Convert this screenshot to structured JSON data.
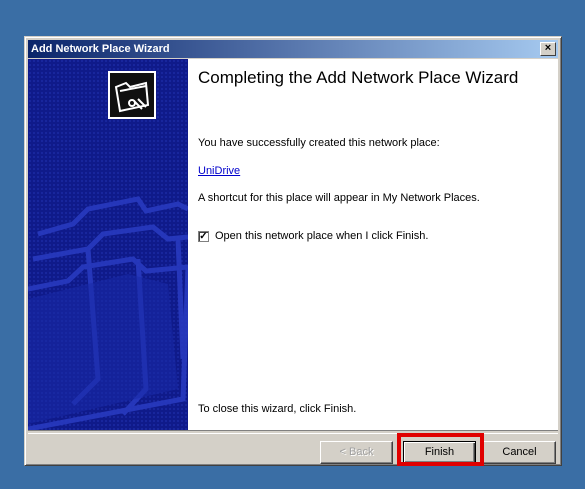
{
  "window": {
    "title": "Add Network Place Wizard",
    "close_label": "×"
  },
  "main": {
    "heading": "Completing the Add Network Place Wizard",
    "success_text": "You have successfully created this network place:",
    "place_name": "UniDrive",
    "shortcut_text": "A shortcut for this place will appear in My Network Places.",
    "open_checkbox": {
      "checked": true,
      "mark": "✓",
      "label": "Open this network place when I click Finish."
    },
    "close_text": "To close this wizard, click Finish."
  },
  "buttons": {
    "back_label": "< Back",
    "finish_label": "Finish",
    "cancel_label": "Cancel"
  },
  "colors": {
    "side_panel": "#0f1a8a",
    "highlight": "#e00000",
    "desktop": "#3a6ea5"
  }
}
